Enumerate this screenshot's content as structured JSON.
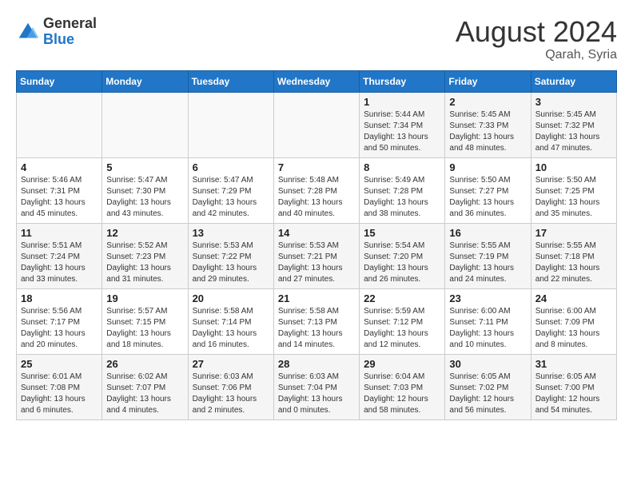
{
  "header": {
    "logo_line1": "General",
    "logo_line2": "Blue",
    "month_year": "August 2024",
    "location": "Qarah, Syria"
  },
  "weekdays": [
    "Sunday",
    "Monday",
    "Tuesday",
    "Wednesday",
    "Thursday",
    "Friday",
    "Saturday"
  ],
  "weeks": [
    [
      {
        "day": "",
        "info": ""
      },
      {
        "day": "",
        "info": ""
      },
      {
        "day": "",
        "info": ""
      },
      {
        "day": "",
        "info": ""
      },
      {
        "day": "1",
        "info": "Sunrise: 5:44 AM\nSunset: 7:34 PM\nDaylight: 13 hours\nand 50 minutes."
      },
      {
        "day": "2",
        "info": "Sunrise: 5:45 AM\nSunset: 7:33 PM\nDaylight: 13 hours\nand 48 minutes."
      },
      {
        "day": "3",
        "info": "Sunrise: 5:45 AM\nSunset: 7:32 PM\nDaylight: 13 hours\nand 47 minutes."
      }
    ],
    [
      {
        "day": "4",
        "info": "Sunrise: 5:46 AM\nSunset: 7:31 PM\nDaylight: 13 hours\nand 45 minutes."
      },
      {
        "day": "5",
        "info": "Sunrise: 5:47 AM\nSunset: 7:30 PM\nDaylight: 13 hours\nand 43 minutes."
      },
      {
        "day": "6",
        "info": "Sunrise: 5:47 AM\nSunset: 7:29 PM\nDaylight: 13 hours\nand 42 minutes."
      },
      {
        "day": "7",
        "info": "Sunrise: 5:48 AM\nSunset: 7:28 PM\nDaylight: 13 hours\nand 40 minutes."
      },
      {
        "day": "8",
        "info": "Sunrise: 5:49 AM\nSunset: 7:28 PM\nDaylight: 13 hours\nand 38 minutes."
      },
      {
        "day": "9",
        "info": "Sunrise: 5:50 AM\nSunset: 7:27 PM\nDaylight: 13 hours\nand 36 minutes."
      },
      {
        "day": "10",
        "info": "Sunrise: 5:50 AM\nSunset: 7:25 PM\nDaylight: 13 hours\nand 35 minutes."
      }
    ],
    [
      {
        "day": "11",
        "info": "Sunrise: 5:51 AM\nSunset: 7:24 PM\nDaylight: 13 hours\nand 33 minutes."
      },
      {
        "day": "12",
        "info": "Sunrise: 5:52 AM\nSunset: 7:23 PM\nDaylight: 13 hours\nand 31 minutes."
      },
      {
        "day": "13",
        "info": "Sunrise: 5:53 AM\nSunset: 7:22 PM\nDaylight: 13 hours\nand 29 minutes."
      },
      {
        "day": "14",
        "info": "Sunrise: 5:53 AM\nSunset: 7:21 PM\nDaylight: 13 hours\nand 27 minutes."
      },
      {
        "day": "15",
        "info": "Sunrise: 5:54 AM\nSunset: 7:20 PM\nDaylight: 13 hours\nand 26 minutes."
      },
      {
        "day": "16",
        "info": "Sunrise: 5:55 AM\nSunset: 7:19 PM\nDaylight: 13 hours\nand 24 minutes."
      },
      {
        "day": "17",
        "info": "Sunrise: 5:55 AM\nSunset: 7:18 PM\nDaylight: 13 hours\nand 22 minutes."
      }
    ],
    [
      {
        "day": "18",
        "info": "Sunrise: 5:56 AM\nSunset: 7:17 PM\nDaylight: 13 hours\nand 20 minutes."
      },
      {
        "day": "19",
        "info": "Sunrise: 5:57 AM\nSunset: 7:15 PM\nDaylight: 13 hours\nand 18 minutes."
      },
      {
        "day": "20",
        "info": "Sunrise: 5:58 AM\nSunset: 7:14 PM\nDaylight: 13 hours\nand 16 minutes."
      },
      {
        "day": "21",
        "info": "Sunrise: 5:58 AM\nSunset: 7:13 PM\nDaylight: 13 hours\nand 14 minutes."
      },
      {
        "day": "22",
        "info": "Sunrise: 5:59 AM\nSunset: 7:12 PM\nDaylight: 13 hours\nand 12 minutes."
      },
      {
        "day": "23",
        "info": "Sunrise: 6:00 AM\nSunset: 7:11 PM\nDaylight: 13 hours\nand 10 minutes."
      },
      {
        "day": "24",
        "info": "Sunrise: 6:00 AM\nSunset: 7:09 PM\nDaylight: 13 hours\nand 8 minutes."
      }
    ],
    [
      {
        "day": "25",
        "info": "Sunrise: 6:01 AM\nSunset: 7:08 PM\nDaylight: 13 hours\nand 6 minutes."
      },
      {
        "day": "26",
        "info": "Sunrise: 6:02 AM\nSunset: 7:07 PM\nDaylight: 13 hours\nand 4 minutes."
      },
      {
        "day": "27",
        "info": "Sunrise: 6:03 AM\nSunset: 7:06 PM\nDaylight: 13 hours\nand 2 minutes."
      },
      {
        "day": "28",
        "info": "Sunrise: 6:03 AM\nSunset: 7:04 PM\nDaylight: 13 hours\nand 0 minutes."
      },
      {
        "day": "29",
        "info": "Sunrise: 6:04 AM\nSunset: 7:03 PM\nDaylight: 12 hours\nand 58 minutes."
      },
      {
        "day": "30",
        "info": "Sunrise: 6:05 AM\nSunset: 7:02 PM\nDaylight: 12 hours\nand 56 minutes."
      },
      {
        "day": "31",
        "info": "Sunrise: 6:05 AM\nSunset: 7:00 PM\nDaylight: 12 hours\nand 54 minutes."
      }
    ]
  ]
}
